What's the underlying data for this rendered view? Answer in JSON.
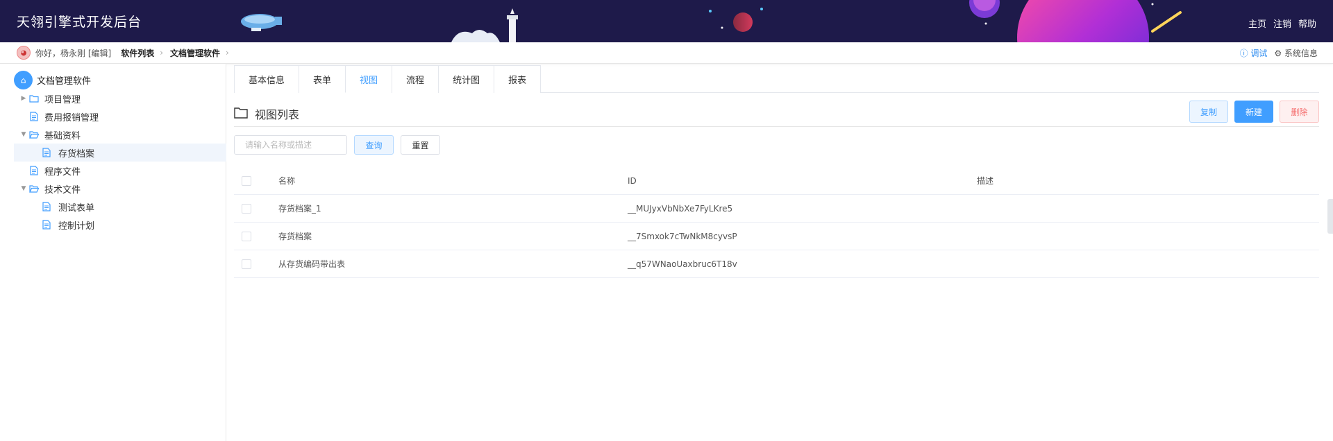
{
  "header": {
    "title": "天翎引擎式开发后台",
    "nav": [
      "主页",
      "注销",
      "帮助"
    ]
  },
  "crumbbar": {
    "greeting": "你好，杨永刚 [编辑]",
    "crumbs": [
      "软件列表",
      "文档管理软件"
    ],
    "debug": "ⓘ 调试",
    "sysinfo": "⚙ 系统信息"
  },
  "sidebar": {
    "root": "文档管理软件",
    "items": [
      {
        "label": "项目管理",
        "type": "folder",
        "level": 1,
        "expand": "collapsed"
      },
      {
        "label": "费用报销管理",
        "type": "doc",
        "level": 1
      },
      {
        "label": "基础资料",
        "type": "folder-open",
        "level": 1,
        "expand": "expanded"
      },
      {
        "label": "存货档案",
        "type": "doc",
        "level": 2,
        "selected": true
      },
      {
        "label": "程序文件",
        "type": "doc",
        "level": 1
      },
      {
        "label": "技术文件",
        "type": "folder-open",
        "level": 1,
        "expand": "expanded"
      },
      {
        "label": "测试表单",
        "type": "doc",
        "level": 2
      },
      {
        "label": "控制计划",
        "type": "doc",
        "level": 2
      }
    ]
  },
  "main": {
    "tabs": [
      "基本信息",
      "表单",
      "视图",
      "流程",
      "统计图",
      "报表"
    ],
    "active_tab": "视图",
    "section_title": "视图列表",
    "buttons": {
      "copy": "复制",
      "new": "新建",
      "delete": "删除",
      "query": "查询",
      "reset": "重置"
    },
    "search_placeholder": "请输入名称或描述",
    "table": {
      "headers": [
        "名称",
        "ID",
        "描述"
      ],
      "rows": [
        {
          "name": "存货档案_1",
          "id": "__MUJyxVbNbXe7FyLKre5",
          "desc": ""
        },
        {
          "name": "存货档案",
          "id": "__7Smxok7cTwNkM8cyvsP",
          "desc": ""
        },
        {
          "name": "从存货编码带出表",
          "id": "__q57WNaoUaxbruc6T18v",
          "desc": ""
        }
      ]
    }
  },
  "colors": {
    "header_bg": "#1e1a4a",
    "accent": "#409eff",
    "danger": "#f56c6c"
  }
}
